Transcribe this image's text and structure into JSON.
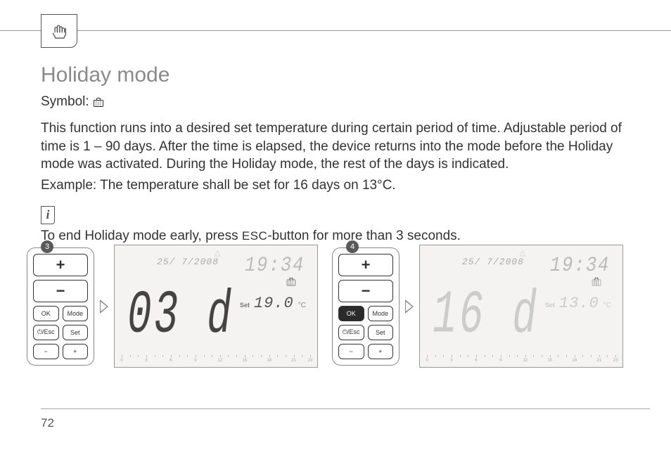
{
  "heading": "Holiday mode",
  "symbol_label": "Symbol:",
  "paragraph": "This function runs into a desired set temperature during certain period of time. Adjustable period of time is 1 – 90 days. After the time is elapsed, the device returns into the mode before the Holiday mode was activated. During the Holiday mode, the rest of the days is indicated.",
  "example": "Example: The temperature shall be set for 16 days on 13°C.",
  "tip_pre": "To end Holiday mode early, press ",
  "tip_esc": "ESC",
  "tip_post": "-button for more than 3 seconds.",
  "page_number": "72",
  "steps": {
    "a": {
      "badge": "3",
      "keypad": {
        "plus": "+",
        "minus": "−",
        "ok": "OK",
        "mode": "Mode",
        "esc": "⏻/Esc",
        "set": "Set",
        "small_minus": "−",
        "small_plus": "+"
      },
      "lcd": {
        "date": "25/ 7/2008",
        "time": "19:34",
        "big": "03 d",
        "set_label": "Set",
        "temp": "19.0",
        "unit": "°C"
      }
    },
    "b": {
      "badge": "4",
      "keypad": {
        "plus": "+",
        "minus": "−",
        "ok": "OK",
        "mode": "Mode",
        "esc": "⏻/Esc",
        "set": "Set",
        "small_minus": "−",
        "small_plus": "+"
      },
      "lcd": {
        "date": "25/ 7/2008",
        "time": "19:34",
        "big": "16 d",
        "set_label": "Set",
        "temp": "13.0",
        "unit": "°C"
      }
    }
  },
  "ruler_labels": [
    "0",
    "3",
    "6",
    "9",
    "12",
    "15",
    "18",
    "21",
    "23"
  ]
}
